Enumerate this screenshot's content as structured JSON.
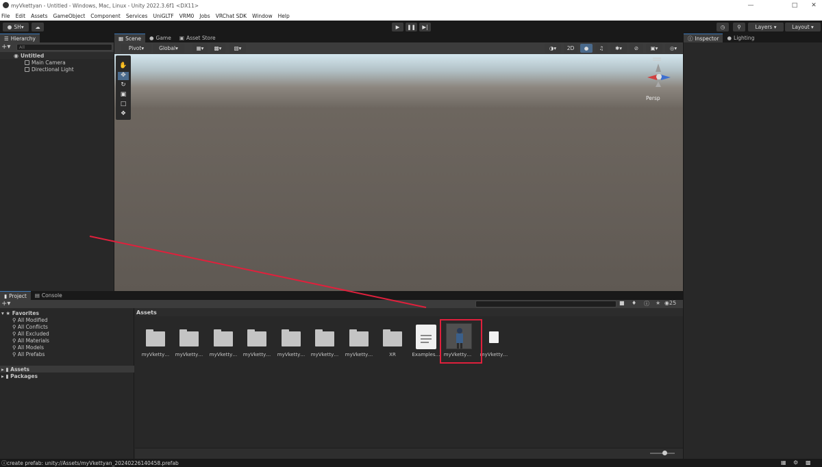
{
  "window": {
    "title": "myVkettyan - Untitled - Windows, Mac, Linux - Unity 2022.3.6f1 <DX11>"
  },
  "menu": [
    "File",
    "Edit",
    "Assets",
    "GameObject",
    "Component",
    "Services",
    "UniGLTF",
    "VRM0",
    "Jobs",
    "VRChat SDK",
    "Window",
    "Help"
  ],
  "toolbar": {
    "account": "SH",
    "layers": "Layers",
    "layout": "Layout"
  },
  "hierarchy": {
    "tab": "Hierarchy",
    "search_placeholder": "All",
    "scene": "Untitled",
    "items": [
      "Main Camera",
      "Directional Light"
    ]
  },
  "scene_tabs": [
    "Scene",
    "Game",
    "Asset Store"
  ],
  "scene_toolbar": {
    "pivot": "Pivot",
    "global": "Global",
    "mode_2d": "2D"
  },
  "scene_view": {
    "persp": "Persp",
    "colors": {
      "sky": "#cfe3ec",
      "ground": "#5f5953"
    }
  },
  "inspector_tabs": [
    "Inspector",
    "Lighting"
  ],
  "project": {
    "tabs": [
      "Project",
      "Console"
    ],
    "favorites_header": "Favorites",
    "favorites": [
      "All Modified",
      "All Conflicts",
      "All Excluded",
      "All Materials",
      "All Models",
      "All Prefabs"
    ],
    "roots": [
      "Assets",
      "Packages"
    ],
    "breadcrumb": "Assets",
    "hidden_count": "25",
    "assets": [
      {
        "label": "myVketty…",
        "kind": "folder"
      },
      {
        "label": "myVketty…",
        "kind": "folder"
      },
      {
        "label": "myVketty…",
        "kind": "folder"
      },
      {
        "label": "myVketty…",
        "kind": "folder"
      },
      {
        "label": "myVketty…",
        "kind": "folder"
      },
      {
        "label": "myVketty…",
        "kind": "folder"
      },
      {
        "label": "myVketty…",
        "kind": "folder"
      },
      {
        "label": "XR",
        "kind": "folder"
      },
      {
        "label": "Examples…",
        "kind": "document"
      },
      {
        "label": "myVketty…",
        "kind": "prefab"
      },
      {
        "label": "myVketty…",
        "kind": "file"
      }
    ],
    "highlight_color": "#e0203c"
  },
  "status": {
    "message": "create prefab: unity://Assets/myVkettyan_20240226140458.prefab"
  }
}
